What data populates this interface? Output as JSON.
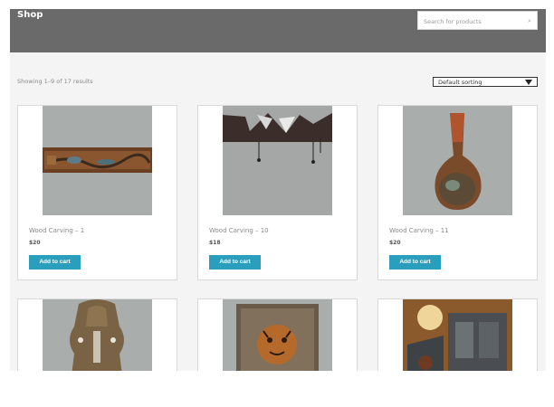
{
  "header": {
    "title": "Shop",
    "search_placeholder": "Search for products",
    "search_icon": "search-icon"
  },
  "toolbar": {
    "result_count": "Showing 1–9 of 17 results",
    "sort_value": "Default sorting"
  },
  "products": [
    {
      "title": "Wood Carving – 1",
      "price": "$20",
      "button": "Add to cart"
    },
    {
      "title": "Wood Carving – 10",
      "price": "$18",
      "button": "Add to cart"
    },
    {
      "title": "Wood Carving – 11",
      "price": "$20",
      "button": "Add to cart"
    },
    {
      "title": "",
      "price": "",
      "button": ""
    },
    {
      "title": "",
      "price": "",
      "button": ""
    },
    {
      "title": "",
      "price": "",
      "button": ""
    }
  ],
  "colors": {
    "header_bg": "#6a6a6a",
    "button_bg": "#2a9fbd",
    "page_bg": "#f4f4f4"
  }
}
